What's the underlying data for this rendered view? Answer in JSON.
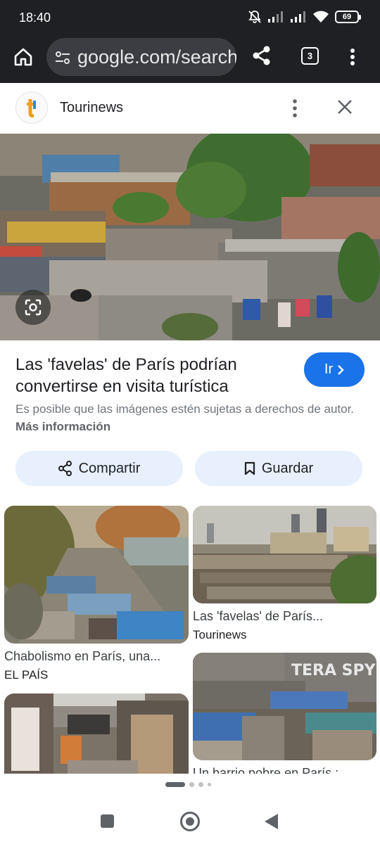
{
  "status_bar": {
    "time": "18:40",
    "battery": "69"
  },
  "browser": {
    "url": "google.com/search",
    "tab_count": "3"
  },
  "source": {
    "name": "Tourinews",
    "logo_letter": "t"
  },
  "result": {
    "title": "Las 'favelas' de París podrían convertirse en visita turística",
    "go_label": "Ir",
    "copyright_text": "Es posible que las imágenes estén sujetas a derechos de autor.",
    "more_info": "Más información"
  },
  "actions": {
    "share_label": "Compartir",
    "save_label": "Guardar"
  },
  "grid": [
    {
      "title": "Chabolismo en París, una...",
      "source": "EL PAÍS"
    },
    {
      "title": "Las 'favelas' de París...",
      "source": "Tourinews"
    },
    {
      "title": "",
      "source": ""
    },
    {
      "title": "Un barrio pobre en París :",
      "source": ""
    }
  ],
  "graffiti_text": "TERA SPY",
  "colors": {
    "accent": "#1a73e8",
    "chip_bg": "#e8f0fe",
    "toolbar_bg": "#1f2024"
  },
  "icons": [
    "home-icon",
    "tune-icon",
    "share-icon",
    "tabs-icon",
    "more-vert-icon",
    "close-icon",
    "lens-icon",
    "chevron-right-icon",
    "bookmark-icon"
  ]
}
